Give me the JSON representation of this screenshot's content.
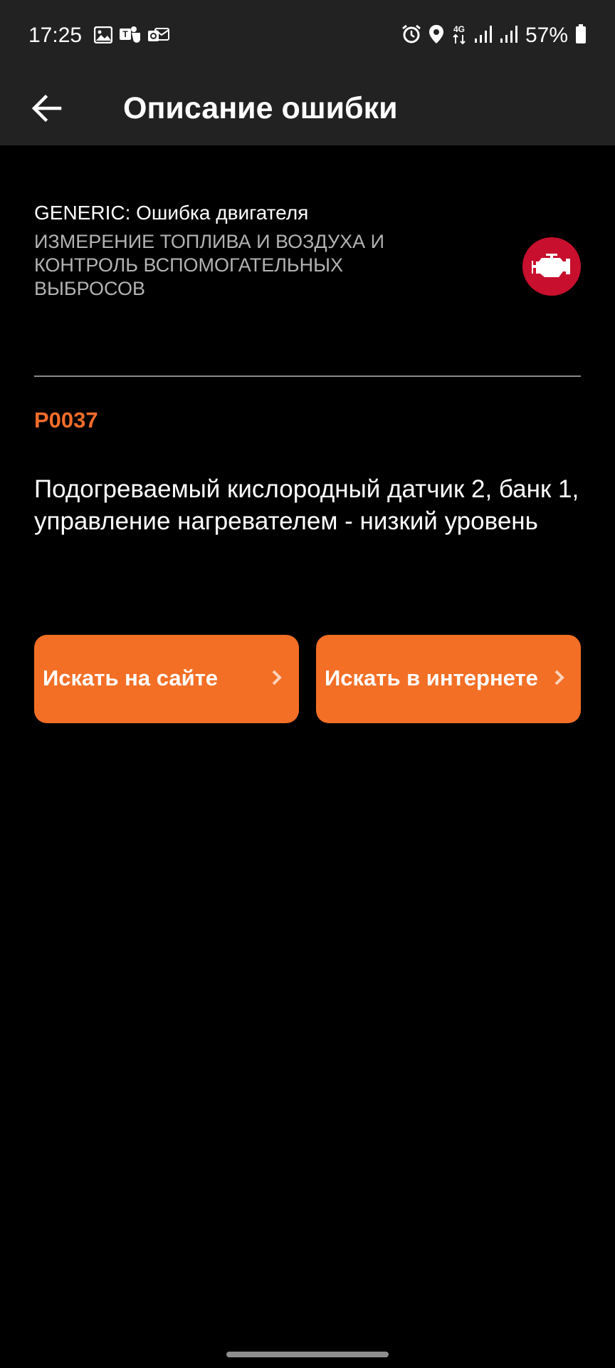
{
  "status_bar": {
    "time": "17:25",
    "left_icons": [
      "gallery-icon",
      "teams-icon",
      "outlook-icon"
    ],
    "right_icons": [
      "alarm-icon",
      "location-icon",
      "4g-data-icon",
      "signal-icon",
      "signal-icon"
    ],
    "network_label": "4G",
    "battery": "57%"
  },
  "app_bar": {
    "back_icon": "arrow-left-icon",
    "title": "Описание ошибки"
  },
  "error": {
    "category": "GENERIC: Ошибка двигателя",
    "subcategory": "ИЗМЕРЕНИЕ ТОПЛИВА И ВОЗДУХА И КОНТРОЛЬ ВСПОМОГАТЕЛЬНЫХ ВЫБРОСОВ",
    "badge_icon": "check-engine-icon",
    "code": "P0037",
    "description": "Подогреваемый кислородный датчик 2, банк 1, управление нагревателем - низкий уровень"
  },
  "actions": {
    "search_site": "Искать на сайте",
    "search_web": "Искать в интернете"
  },
  "colors": {
    "background": "#000000",
    "bar_background": "#222222",
    "accent": "#f36f26",
    "code_color": "#f26c2a",
    "badge_red": "#c8102e",
    "muted_text": "#b3b3b3"
  }
}
